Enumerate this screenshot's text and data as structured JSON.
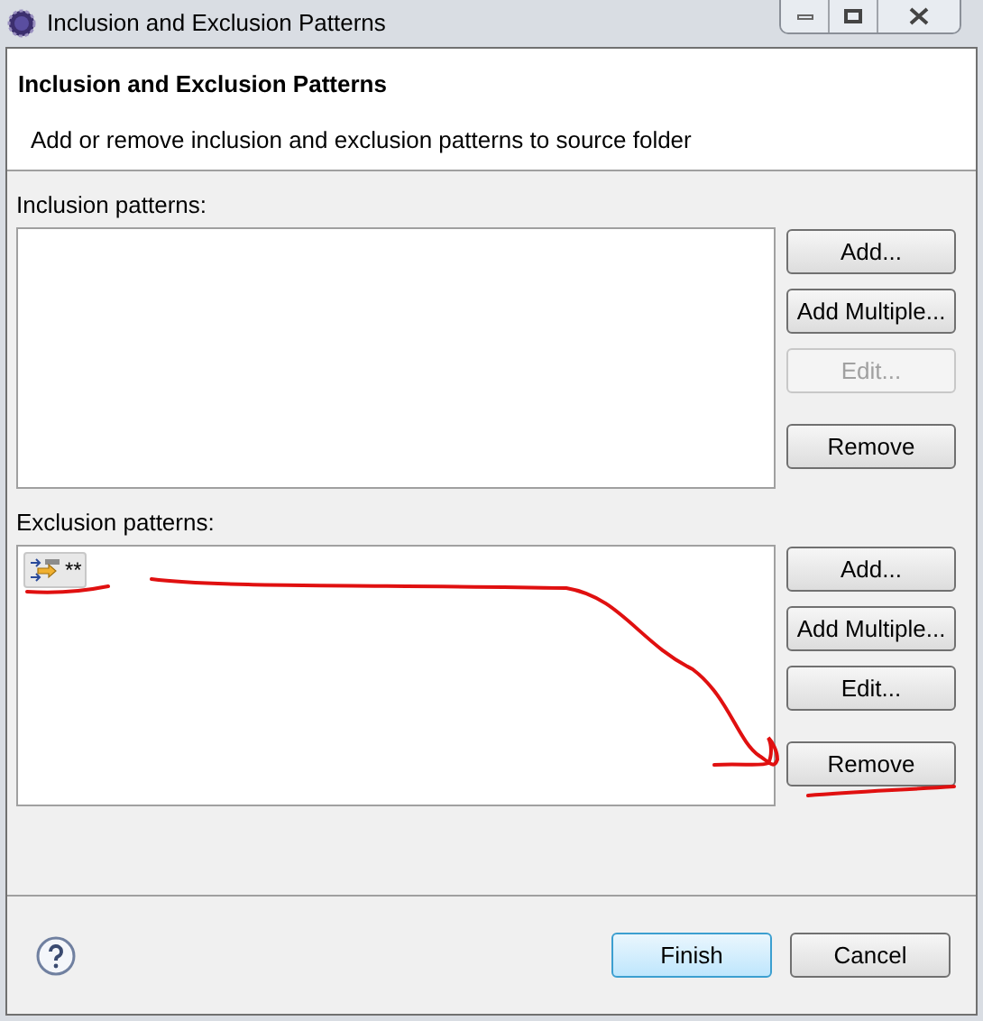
{
  "window": {
    "title": "Inclusion and Exclusion Patterns"
  },
  "header": {
    "title": "Inclusion and Exclusion Patterns",
    "description": "Add or remove inclusion and exclusion patterns to source folder"
  },
  "inclusion": {
    "label": "Inclusion patterns:",
    "buttons": [
      {
        "label": "Add...",
        "disabled": false
      },
      {
        "label": "Add Multiple...",
        "disabled": false
      },
      {
        "label": "Edit...",
        "disabled": true
      },
      {
        "label": "Remove",
        "disabled": false
      }
    ]
  },
  "exclusion": {
    "label": "Exclusion patterns:",
    "entries": [
      {
        "text": "**",
        "selected": true
      }
    ],
    "buttons": [
      {
        "label": "Add...",
        "disabled": false
      },
      {
        "label": "Add Multiple...",
        "disabled": false
      },
      {
        "label": "Edit...",
        "disabled": false
      },
      {
        "label": "Remove",
        "disabled": false
      }
    ]
  },
  "footer": {
    "buttons": [
      {
        "label": "Finish",
        "default": true
      },
      {
        "label": "Cancel",
        "default": false
      }
    ]
  }
}
